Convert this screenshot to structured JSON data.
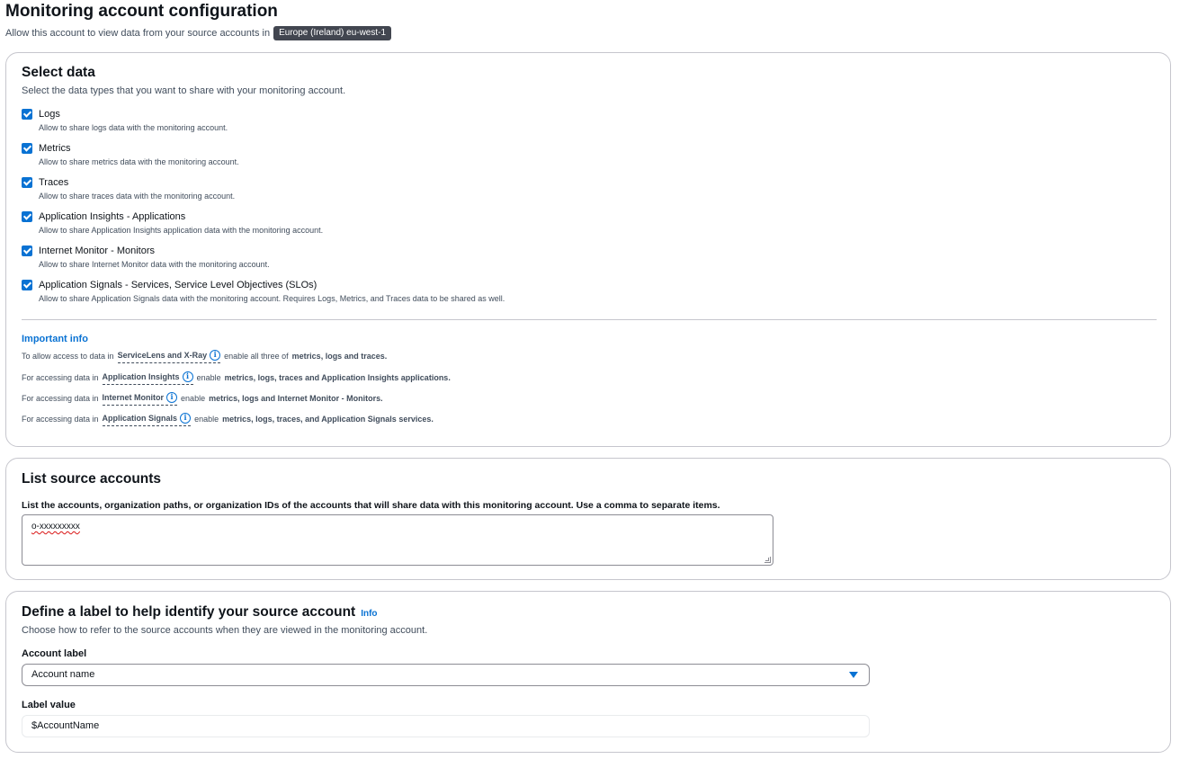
{
  "header": {
    "title": "Monitoring account configuration",
    "subtitle": "Allow this account to view data from your source accounts in",
    "region": "Europe (Ireland) eu-west-1"
  },
  "select_data": {
    "title": "Select data",
    "description": "Select the data types that you want to share with your monitoring account.",
    "options": [
      {
        "label": "Logs",
        "description": "Allow to share logs data with the monitoring account.",
        "checked": true
      },
      {
        "label": "Metrics",
        "description": "Allow to share metrics data with the monitoring account.",
        "checked": true
      },
      {
        "label": "Traces",
        "description": "Allow to share traces data with the monitoring account.",
        "checked": true
      },
      {
        "label": "Application Insights - Applications",
        "description": "Allow to share Application Insights application data with the monitoring account.",
        "checked": true
      },
      {
        "label": "Internet Monitor - Monitors",
        "description": "Allow to share Internet Monitor data with the monitoring account.",
        "checked": true
      },
      {
        "label": "Application Signals - Services, Service Level Objectives (SLOs)",
        "description": "Allow to share Application Signals data with the monitoring account. Requires Logs, Metrics, and Traces data to be shared as well.",
        "checked": true
      }
    ],
    "important_info": {
      "heading": "Important info",
      "lines": [
        {
          "prefix": "To allow access to data in",
          "term": "ServiceLens and X-Ray",
          "middle": "enable all three of",
          "bold": "metrics, logs and traces."
        },
        {
          "prefix": "For accessing data in",
          "term": "Application Insights",
          "middle": "enable",
          "bold": "metrics, logs, traces and Application Insights applications."
        },
        {
          "prefix": "For accessing data in",
          "term": "Internet Monitor",
          "middle": "enable",
          "bold": "metrics, logs and Internet Monitor - Monitors."
        },
        {
          "prefix": "For accessing data in",
          "term": "Application Signals",
          "middle": "enable",
          "bold": "metrics, logs, traces, and Application Signals services."
        }
      ]
    }
  },
  "source_accounts": {
    "title": "List source accounts",
    "description": "List the accounts, organization paths, or organization IDs of the accounts that will share data with this monitoring account. Use a comma to separate items.",
    "value": "o-xxxxxxxxx"
  },
  "label_section": {
    "title": "Define a label to help identify your source account",
    "info_link": "Info",
    "description": "Choose how to refer to the source accounts when they are viewed in the monitoring account.",
    "account_label": {
      "label": "Account label",
      "selected": "Account name"
    },
    "label_value": {
      "label": "Label value",
      "value": "$AccountName"
    }
  },
  "colors": {
    "accent": "#0972d3",
    "badge": "#424650",
    "border": "#c6c6cd"
  }
}
